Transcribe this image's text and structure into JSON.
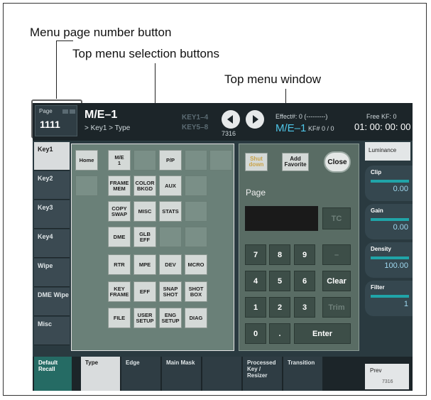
{
  "callouts": {
    "page_number_button": "Menu page number button",
    "top_menu_selection": "Top menu selection buttons",
    "top_menu_window": "Top menu window"
  },
  "header": {
    "page_label": "Page",
    "page_number": "1111",
    "title": "M/E–1",
    "path": "> Key1 > Type",
    "key_line1": "KEY1–4",
    "key_line2": "KEY5–8",
    "nav_number": "7316",
    "effect": "Effect#: 0 (---------)",
    "effect_me": "M/E–1",
    "kf": "KF# 0 / 0",
    "free_kf": "Free KF: 0",
    "timecode": "01: 00: 00: 00"
  },
  "left_tabs": [
    "Key1",
    "Key2",
    "Key3",
    "Key4",
    "Wipe",
    "DME Wipe",
    "Misc"
  ],
  "hidden_tabs": [
    "Type",
    "Edge",
    "Main Mask"
  ],
  "right_panel": {
    "tab": "Luminance",
    "knobs": [
      {
        "label": "Clip",
        "value": "0.00"
      },
      {
        "label": "Gain",
        "value": "0.00"
      },
      {
        "label": "Density",
        "value": "100.00"
      },
      {
        "label": "Filter",
        "value": "1"
      }
    ]
  },
  "menu_buttons": {
    "home": "Home",
    "rows": [
      [
        "M/E\n1",
        "",
        "P/P",
        "",
        ""
      ],
      [
        "FRAME\nMEM",
        "COLOR\nBKGD",
        "AUX",
        ""
      ],
      [
        "COPY\nSWAP",
        "MISC",
        "STATS",
        ""
      ],
      [
        "DME",
        "GLB\nEFF",
        "",
        ""
      ],
      [
        "RTR",
        "MPE",
        "DEV",
        "MCRO"
      ],
      [
        "KEY\nFRAME",
        "EFF",
        "SNAP\nSHOT",
        "SHOT\nBOX"
      ],
      [
        "FILE",
        "USER\nSETUP",
        "ENG\nSETUP",
        "DIAG"
      ]
    ]
  },
  "window": {
    "shutdown": "Shut\ndown",
    "add_favorite": "Add\nFavorite",
    "close": "Close",
    "page": "Page",
    "tc": "TC",
    "keys": [
      [
        "7",
        "8",
        "9",
        "–"
      ],
      [
        "4",
        "5",
        "6",
        "Clear"
      ],
      [
        "1",
        "2",
        "3",
        "Trim"
      ],
      [
        "0",
        ".",
        "Enter"
      ]
    ]
  },
  "bottom": {
    "default_recall": "Default\nRecall",
    "tabs": [
      "Type",
      "Edge",
      "Main Mask",
      "",
      "Processed\nKey /\nResizer",
      "Transition"
    ],
    "prev": "Prev",
    "prev_num": "7316"
  }
}
